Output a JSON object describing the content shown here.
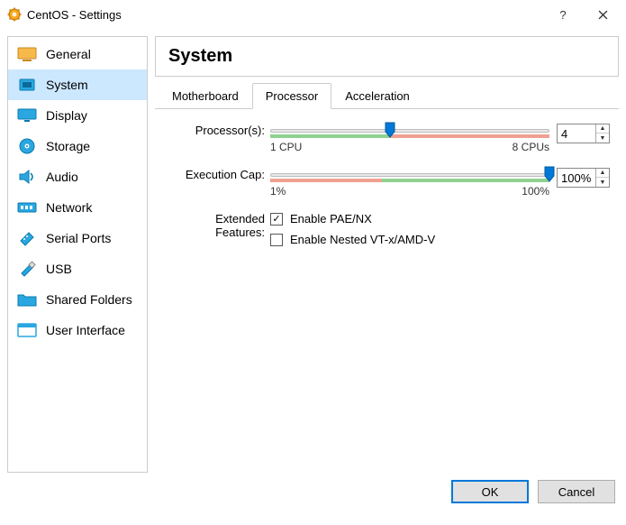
{
  "window": {
    "title": "CentOS - Settings"
  },
  "sidebar": {
    "items": [
      {
        "label": "General"
      },
      {
        "label": "System"
      },
      {
        "label": "Display"
      },
      {
        "label": "Storage"
      },
      {
        "label": "Audio"
      },
      {
        "label": "Network"
      },
      {
        "label": "Serial Ports"
      },
      {
        "label": "USB"
      },
      {
        "label": "Shared Folders"
      },
      {
        "label": "User Interface"
      }
    ]
  },
  "content": {
    "heading": "System",
    "tabs": {
      "motherboard": "Motherboard",
      "processor": "Processor",
      "acceleration": "Acceleration"
    },
    "processors": {
      "label": "Processor(s):",
      "value": "4",
      "min_label": "1 CPU",
      "max_label": "8 CPUs"
    },
    "execcap": {
      "label": "Execution Cap:",
      "value": "100%",
      "min_label": "1%",
      "max_label": "100%"
    },
    "extended": {
      "label": "Extended Features:",
      "pae": "Enable PAE/NX",
      "nested": "Enable Nested VT-x/AMD-V"
    }
  },
  "buttons": {
    "ok": "OK",
    "cancel": "Cancel"
  }
}
